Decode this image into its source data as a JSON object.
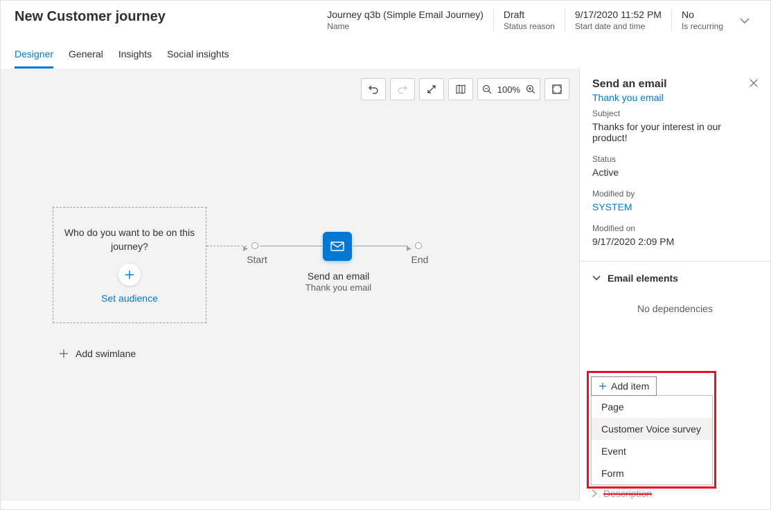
{
  "header": {
    "title": "New Customer journey",
    "meta": {
      "name_value": "Journey q3b (Simple Email Journey)",
      "name_label": "Name",
      "status_value": "Draft",
      "status_label": "Status reason",
      "start_value": "9/17/2020 11:52 PM",
      "start_label": "Start date and time",
      "recurring_value": "No",
      "recurring_label": "Is recurring"
    }
  },
  "tabs": {
    "designer": "Designer",
    "general": "General",
    "insights": "Insights",
    "social": "Social insights"
  },
  "canvas": {
    "zoom": "100%",
    "audience_q": "Who do you want to be on this journey?",
    "set_audience": "Set audience",
    "add_swimlane": "Add swimlane",
    "start_label": "Start",
    "end_label": "End",
    "email_title": "Send an email",
    "email_sub": "Thank you email"
  },
  "panel": {
    "title": "Send an email",
    "link": "Thank you email",
    "subject_label": "Subject",
    "subject_value": "Thanks for your interest in our product!",
    "status_label": "Status",
    "status_value": "Active",
    "modby_label": "Modified by",
    "modby_value": "SYSTEM",
    "modon_label": "Modified on",
    "modon_value": "9/17/2020 2:09 PM",
    "elements_title": "Email elements",
    "nodep": "No dependencies",
    "add_item": "Add item",
    "options": {
      "page": "Page",
      "cvs": "Customer Voice survey",
      "event": "Event",
      "form": "Form"
    },
    "desc": "Description"
  }
}
